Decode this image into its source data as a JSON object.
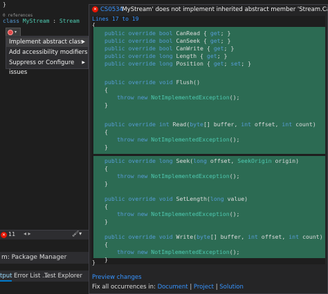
{
  "editor": {
    "brace_top": "}",
    "refs": "0 references",
    "class_kw": "class",
    "class_name": "MyStream",
    "colon": " : ",
    "base": "Stream",
    "brace_open": "{"
  },
  "lightbulb": {
    "icon": "error-lightbulb-icon",
    "arrow": "▾"
  },
  "menu": {
    "items": [
      {
        "label": "Implement abstract class",
        "submenu": "▶"
      },
      {
        "label": "Add accessibility modifiers",
        "submenu": ""
      },
      {
        "label": "Suppress or Configure issues",
        "submenu": "▶"
      }
    ]
  },
  "errorbar": {
    "count": "11",
    "arrows": "◂ ▸",
    "brush": "🖌▾"
  },
  "package_manager": "m:  Package Manager",
  "bottom_tabs": [
    "tput",
    "Error List ...",
    "Test Explorer"
  ],
  "preview": {
    "error_code": "CS0534",
    "message": "'MyStream' does not implement inherited abstract member 'Stream.CanSeek.get'",
    "lines_label": "Lines 17 to 19",
    "open_brace": "{",
    "close_brace": "}",
    "preview_changes": "Preview changes",
    "fix_all_label": "Fix all occurrences in:",
    "fix_document": "Document",
    "fix_project": "Project",
    "fix_solution": "Solution",
    "sep": "|"
  },
  "code": {
    "l1": [
      "public override bool ",
      "CanRead",
      " { ",
      "get",
      "; }"
    ],
    "l2": [
      "public override bool ",
      "CanSeek",
      " { ",
      "get",
      "; }"
    ],
    "l3": [
      "public override bool ",
      "CanWrite",
      " { ",
      "get",
      "; }"
    ],
    "l4": [
      "public override long ",
      "Length",
      " { ",
      "get",
      "; }"
    ],
    "l5": [
      "public override long ",
      "Position",
      " { ",
      "get",
      "; ",
      "set",
      "; }"
    ],
    "flush": [
      "public override void ",
      "Flush",
      "()"
    ],
    "throw_kw": "throw new ",
    "throw_type": "NotImplementedException",
    "throw_end": "();",
    "ob": "{",
    "cb": "}",
    "read": [
      "public override ",
      "int ",
      "Read",
      "(",
      "byte",
      "[] buffer, ",
      "int ",
      "offset, ",
      "int ",
      "count)"
    ],
    "seek": [
      "public override ",
      "long ",
      "Seek",
      "(",
      "long ",
      "offset, ",
      "SeekOrigin",
      " origin)"
    ],
    "setlength": [
      "public override void ",
      "SetLength",
      "(",
      "long ",
      "value)"
    ],
    "write": [
      "public override void ",
      "Write",
      "(",
      "byte",
      "[] buffer, ",
      "int ",
      "offset, ",
      "int ",
      "count)"
    ]
  }
}
